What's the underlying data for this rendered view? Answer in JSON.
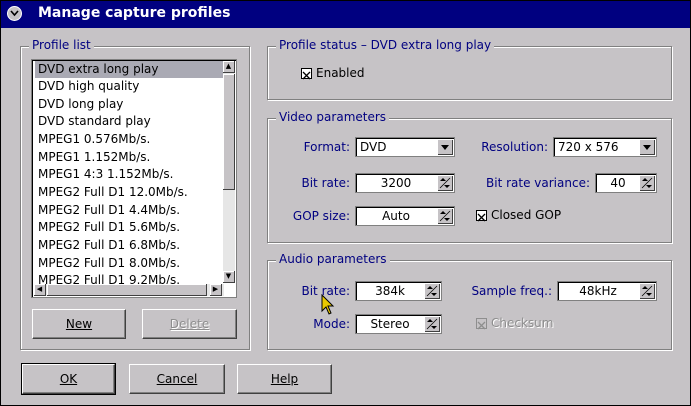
{
  "window": {
    "title": "Manage capture profiles"
  },
  "profile_list": {
    "legend": "Profile list",
    "items": [
      "DVD extra long play",
      "DVD high quality",
      "DVD long play",
      "DVD standard play",
      "MPEG1 0.576Mb/s.",
      "MPEG1 1.152Mb/s.",
      "MPEG1 4:3 1.152Mb/s.",
      "MPEG2 Full D1 12.0Mb/s.",
      "MPEG2 Full D1 4.4Mb/s.",
      "MPEG2 Full D1 5.6Mb/s.",
      "MPEG2 Full D1 6.8Mb/s.",
      "MPEG2 Full D1 8.0Mb/s.",
      "MPEG2 Full D1 9.2Mb/s."
    ],
    "selected_index": 0,
    "new_label": "New",
    "delete_label": "Delete"
  },
  "profile_status": {
    "legend": "Profile status – DVD extra long play",
    "enabled_label": "Enabled",
    "enabled_checked": true
  },
  "video": {
    "legend": "Video parameters",
    "format_label": "Format:",
    "format_value": "DVD",
    "resolution_label": "Resolution:",
    "resolution_value": "720 x 576",
    "bitrate_label": "Bit rate:",
    "bitrate_value": "3200",
    "variance_label": "Bit rate variance:",
    "variance_value": "40",
    "gop_label": "GOP size:",
    "gop_value": "Auto",
    "closed_gop_label": "Closed GOP",
    "closed_gop_checked": true
  },
  "audio": {
    "legend": "Audio parameters",
    "bitrate_label": "Bit rate:",
    "bitrate_value": "384k",
    "sample_label": "Sample freq.:",
    "sample_value": "48kHz",
    "mode_label": "Mode:",
    "mode_value": "Stereo",
    "checksum_label": "Checksum",
    "checksum_checked": true
  },
  "footer": {
    "ok_label": "OK",
    "cancel_label": "Cancel",
    "help_label": "Help"
  },
  "colors": {
    "titlebar": "#000080",
    "label_blue": "#000080",
    "selection": "#aaaab4"
  }
}
